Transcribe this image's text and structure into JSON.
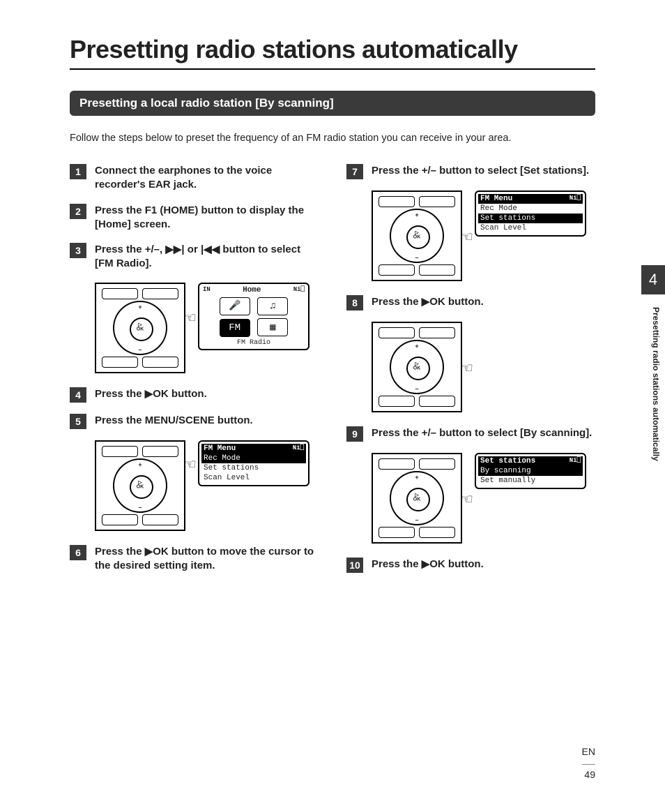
{
  "chapter_number": "4",
  "side_caption": "Presetting radio stations automatically",
  "page_title": "Presetting radio stations automatically",
  "section_heading": "Presetting a local radio station [By scanning]",
  "intro_text": "Follow the steps below to preset the frequency of an FM radio station you can receive in your area.",
  "steps": {
    "s1": {
      "num": "1",
      "text_a": "Connect the earphones to the voice recorder's ",
      "bold_a": "EAR",
      "text_b": " jack."
    },
    "s2": {
      "num": "2",
      "text_a": "Press the ",
      "bold_a": "F1 (HOME)",
      "text_b": " button to display the [",
      "bold_b": "Home",
      "text_c": "] screen."
    },
    "s3": {
      "num": "3",
      "text_a": "Press the ",
      "bold_a": "+/–",
      "text_b": ", ",
      "glyph_a": "▶▶|",
      "text_c": " or ",
      "glyph_b": "|◀◀",
      "text_d": " button to select [",
      "bold_b": "FM Radio",
      "text_e": "]."
    },
    "s4": {
      "num": "4",
      "text_a": "Press the ",
      "glyph_a": "▶",
      "bold_a": "OK",
      "text_b": " button."
    },
    "s5": {
      "num": "5",
      "text_a": "Press the ",
      "bold_a": "MENU/SCENE",
      "text_b": " button."
    },
    "s6": {
      "num": "6",
      "text_a": "Press the ",
      "glyph_a": "▶",
      "bold_a": "OK",
      "text_b": " button to move the cursor to the desired setting item."
    },
    "s7": {
      "num": "7",
      "text_a": "Press the ",
      "bold_a": "+/–",
      "text_b": " button to select [",
      "bold_b": "Set stations",
      "text_c": "]."
    },
    "s8": {
      "num": "8",
      "text_a": "Press the ",
      "glyph_a": "▶",
      "bold_a": "OK",
      "text_b": " button."
    },
    "s9": {
      "num": "9",
      "text_a": "Press the ",
      "bold_a": "+/–",
      "text_b": " button to select [",
      "bold_b": "By scanning",
      "text_c": "]."
    },
    "s10": {
      "num": "10",
      "text_a": "Press the ",
      "glyph_a": "▶",
      "bold_a": "OK",
      "text_b": " button."
    }
  },
  "screens": {
    "home": {
      "status_left": "IN",
      "title": "Home",
      "status_right": "Ni⎕",
      "caption": "FM Radio",
      "icon_mic": "🎤",
      "icon_music": "♫",
      "icon_fm": "FM",
      "icon_cal": "▦"
    },
    "fmmenu_recmode": {
      "title": "FM Menu",
      "status_right": "Ni⎕",
      "rows": [
        "Rec Mode",
        "Set stations",
        "Scan Level"
      ],
      "selected_index": 0
    },
    "fmmenu_setstations": {
      "title": "FM Menu",
      "status_right": "Ni⎕",
      "rows": [
        "Rec Mode",
        "Set stations",
        "Scan Level"
      ],
      "selected_index": 1
    },
    "setstations": {
      "title": "Set stations",
      "status_right": "Ni⎕",
      "rows": [
        "By scanning",
        "Set manually"
      ],
      "selected_index": 0
    }
  },
  "device_labels": {
    "plus": "+",
    "minus": "–",
    "ok_play": "▷",
    "ok_text": "OK"
  },
  "footer": {
    "lang": "EN",
    "page": "49"
  }
}
